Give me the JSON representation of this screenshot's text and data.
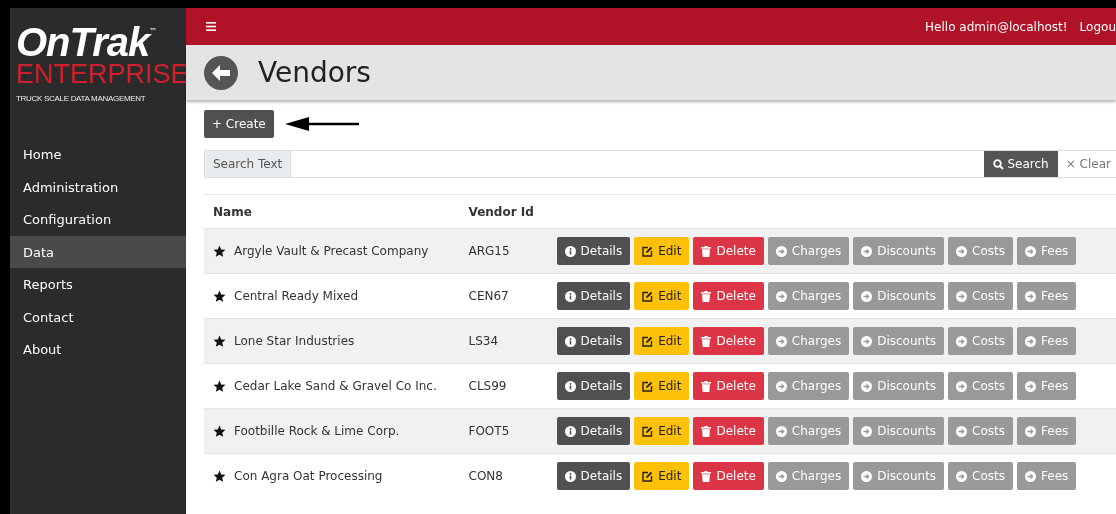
{
  "logo": {
    "brand": "OnTrak",
    "trademark": "™",
    "line2": "ENTERPRISE",
    "tagline": "TRUCK SCALE DATA MANAGEMENT"
  },
  "sidebar": {
    "items": [
      {
        "label": "Home",
        "selected": false
      },
      {
        "label": "Administration",
        "selected": false
      },
      {
        "label": "Configuration",
        "selected": false
      },
      {
        "label": "Data",
        "selected": true
      },
      {
        "label": "Reports",
        "selected": false
      },
      {
        "label": "Contact",
        "selected": false
      },
      {
        "label": "About",
        "selected": false
      }
    ]
  },
  "topbar": {
    "greeting": "Hello admin@localhost!",
    "logout": "Logou"
  },
  "page": {
    "title": "Vendors"
  },
  "create_button": {
    "label": "+ Create"
  },
  "search": {
    "addon": "Search Text",
    "search_button": "Search",
    "clear_icon": "×",
    "clear_button": "Clear"
  },
  "table": {
    "columns": [
      "Name",
      "Vendor Id",
      ""
    ],
    "rows": [
      {
        "name": "Argyle Vault & Precast Company",
        "vendor_id": "ARG15",
        "actions": [
          {
            "kind": "details",
            "label": "Details"
          },
          {
            "kind": "edit",
            "label": "Edit"
          },
          {
            "kind": "delete",
            "label": "Delete"
          },
          {
            "kind": "link",
            "label": "Charges"
          },
          {
            "kind": "link",
            "label": "Discounts"
          },
          {
            "kind": "link",
            "label": "Costs"
          },
          {
            "kind": "link",
            "label": "Fees"
          }
        ]
      },
      {
        "name": "Central Ready Mixed",
        "vendor_id": "CEN67",
        "actions": [
          {
            "kind": "details",
            "label": "Details"
          },
          {
            "kind": "edit",
            "label": "Edit"
          },
          {
            "kind": "delete",
            "label": "Delete"
          },
          {
            "kind": "link",
            "label": "Charges"
          },
          {
            "kind": "link",
            "label": "Discounts"
          },
          {
            "kind": "link",
            "label": "Costs"
          },
          {
            "kind": "link",
            "label": "Fees"
          }
        ]
      },
      {
        "name": "Lone Star Industries",
        "vendor_id": "LS34",
        "actions": [
          {
            "kind": "details",
            "label": "Details"
          },
          {
            "kind": "edit",
            "label": "Edit"
          },
          {
            "kind": "delete",
            "label": "Delete"
          },
          {
            "kind": "link",
            "label": "Charges"
          },
          {
            "kind": "link",
            "label": "Discounts"
          },
          {
            "kind": "link",
            "label": "Costs"
          },
          {
            "kind": "link",
            "label": "Fees"
          }
        ]
      },
      {
        "name": "Cedar Lake Sand & Gravel Co Inc.",
        "vendor_id": "CLS99",
        "actions": [
          {
            "kind": "details",
            "label": "Details"
          },
          {
            "kind": "edit",
            "label": "Edit"
          },
          {
            "kind": "delete",
            "label": "Delete"
          },
          {
            "kind": "link",
            "label": "Charges"
          },
          {
            "kind": "link",
            "label": "Discounts"
          },
          {
            "kind": "link",
            "label": "Costs"
          },
          {
            "kind": "link",
            "label": "Fees"
          }
        ]
      },
      {
        "name": "Footbille Rock & Lime Corp.",
        "vendor_id": "FOOT5",
        "actions": [
          {
            "kind": "details",
            "label": "Details"
          },
          {
            "kind": "edit",
            "label": "Edit"
          },
          {
            "kind": "delete",
            "label": "Delete"
          },
          {
            "kind": "link",
            "label": "Charges"
          },
          {
            "kind": "link",
            "label": "Discounts"
          },
          {
            "kind": "link",
            "label": "Costs"
          },
          {
            "kind": "link",
            "label": "Fees"
          }
        ]
      },
      {
        "name": "Con Agra Oat Processing",
        "vendor_id": "CON8",
        "actions": [
          {
            "kind": "details",
            "label": "Details"
          },
          {
            "kind": "edit",
            "label": "Edit"
          },
          {
            "kind": "delete",
            "label": "Delete"
          },
          {
            "kind": "link",
            "label": "Charges"
          },
          {
            "kind": "link",
            "label": "Discounts"
          },
          {
            "kind": "link",
            "label": "Costs"
          },
          {
            "kind": "link",
            "label": "Fees"
          }
        ]
      }
    ]
  }
}
